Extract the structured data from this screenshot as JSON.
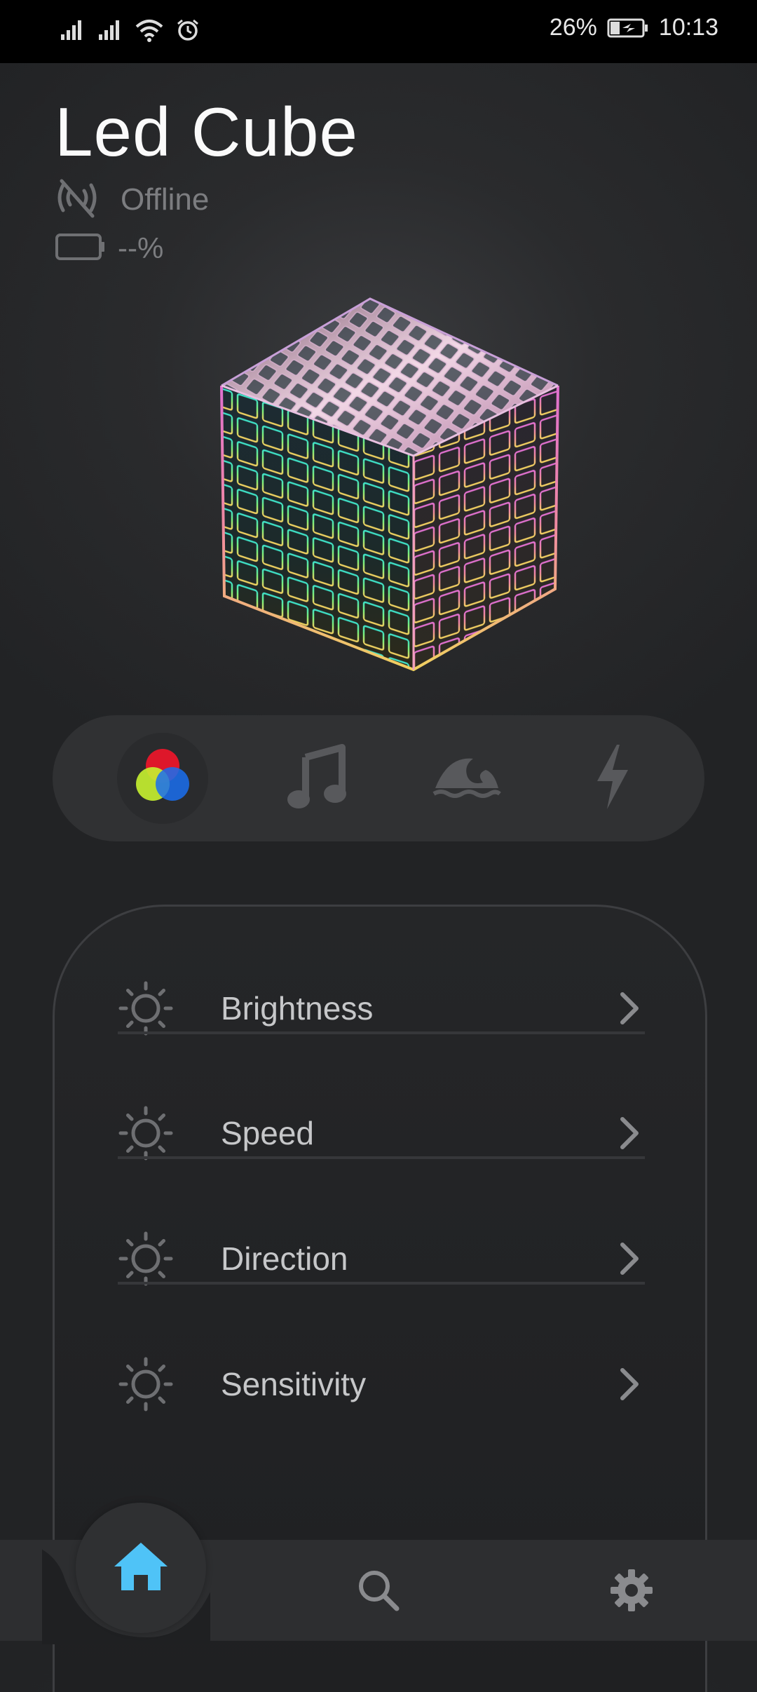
{
  "status_bar": {
    "battery_percent": "26%",
    "time": "10:13",
    "icons": [
      "signal-icon",
      "signal-icon",
      "wifi-icon",
      "alarm-icon",
      "battery-charging-icon"
    ]
  },
  "device": {
    "name": "Led Cube",
    "connection_status": "Offline",
    "battery_level": "--%"
  },
  "modes": [
    {
      "name": "color-mode",
      "icon": "rgb-circles-icon",
      "active": true
    },
    {
      "name": "music-mode",
      "icon": "music-note-icon",
      "active": false
    },
    {
      "name": "wave-mode",
      "icon": "wave-icon",
      "active": false
    },
    {
      "name": "power-mode",
      "icon": "lightning-icon",
      "active": false
    }
  ],
  "settings": {
    "items": [
      {
        "label": "Brightness",
        "icon": "sun-icon"
      },
      {
        "label": "Speed",
        "icon": "sun-icon"
      },
      {
        "label": "Direction",
        "icon": "sun-icon"
      },
      {
        "label": "Sensitivity",
        "icon": "sun-icon"
      }
    ]
  },
  "bottom_nav": {
    "items": [
      {
        "name": "home",
        "icon": "home-icon",
        "active": true
      },
      {
        "name": "search",
        "icon": "search-icon",
        "active": false
      },
      {
        "name": "settings",
        "icon": "gear-icon",
        "active": false
      }
    ]
  },
  "colors": {
    "accent": "#4fc3f7",
    "background": "#2a2b2d",
    "muted_text": "#7c7d80",
    "setting_text": "#c6c7c9"
  }
}
